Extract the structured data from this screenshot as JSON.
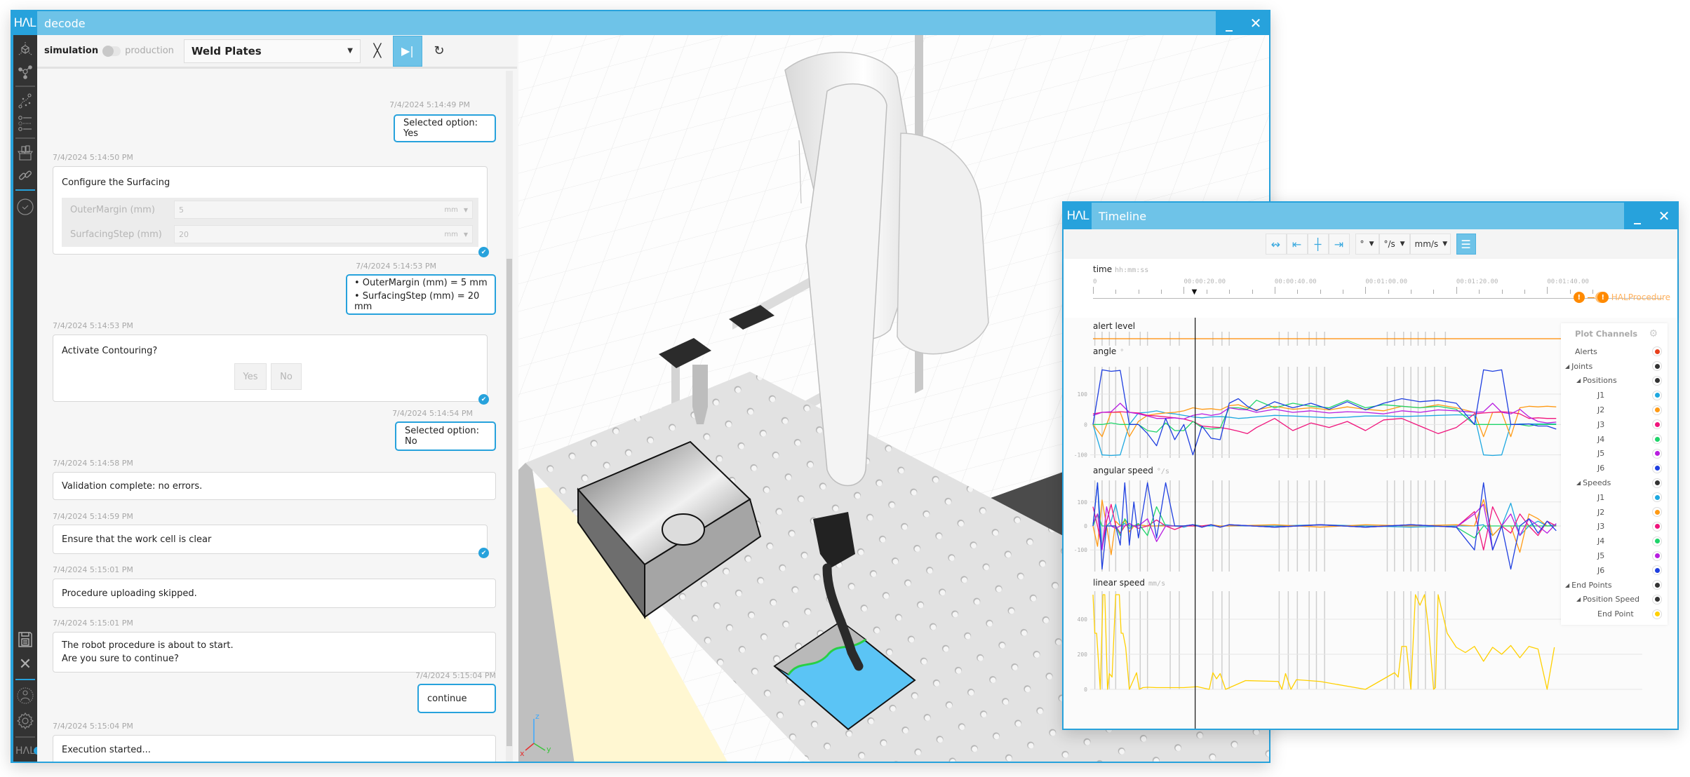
{
  "main_window": {
    "logo": "HΛL",
    "title": "decode",
    "minimize_label": "_",
    "close_label": "✕"
  },
  "sidebar": {
    "items": [
      {
        "name": "scene",
        "icon": "cube-axes-icon"
      },
      {
        "name": "graph",
        "icon": "node-graph-icon"
      },
      {
        "name": "paths",
        "icon": "path-plan-icon"
      },
      {
        "name": "settings-list",
        "icon": "parameter-list-icon"
      },
      {
        "name": "products",
        "icon": "box-parts-icon"
      },
      {
        "name": "links",
        "icon": "link-icon"
      },
      {
        "name": "validate",
        "icon": "check-circle-icon"
      }
    ],
    "bottom_items": [
      {
        "name": "save",
        "icon": "floppy-save-icon"
      },
      {
        "name": "close",
        "icon": "close-x-icon"
      },
      {
        "name": "user",
        "icon": "user-icon"
      },
      {
        "name": "settings",
        "icon": "gear-icon"
      }
    ],
    "footer_logo": "HΛL"
  },
  "toolbar": {
    "mode_left": "simulation",
    "mode_right": "production",
    "mode_production_on": false,
    "procedure_selected": "Weld Plates",
    "stop_symbol": "╳",
    "step_symbol": "▶|",
    "reset_symbol": "↻"
  },
  "chat": {
    "messages": [
      {
        "from": "user",
        "time": "7/4/2024 5:14:49 PM",
        "text": "Selected option: Yes"
      },
      {
        "from": "system",
        "time": "7/4/2024 5:14:50 PM",
        "text": "Configure the Surfacing",
        "form": [
          {
            "label": "OuterMargin (mm)",
            "value": "5",
            "unit": "mm"
          },
          {
            "label": "SurfacingStep (mm)",
            "value": "20",
            "unit": "mm"
          }
        ],
        "confirmed": true
      },
      {
        "from": "user",
        "time": "7/4/2024 5:14:53 PM",
        "lines": [
          "• OuterMargin (mm) = 5 mm",
          "• SurfacingStep (mm) = 20 mm"
        ]
      },
      {
        "from": "system",
        "time": "7/4/2024 5:14:53 PM",
        "text": "Activate Contouring?",
        "buttons": [
          "Yes",
          "No"
        ],
        "confirmed": true
      },
      {
        "from": "user",
        "time": "7/4/2024 5:14:54 PM",
        "text": "Selected option: No"
      },
      {
        "from": "system",
        "time": "7/4/2024 5:14:58 PM",
        "text": "Validation complete: no errors."
      },
      {
        "from": "system",
        "time": "7/4/2024 5:14:59 PM",
        "text": "Ensure that the work cell is clear",
        "confirmed": true
      },
      {
        "from": "system",
        "time": "7/4/2024 5:15:01 PM",
        "text": "Procedure uploading skipped."
      },
      {
        "from": "system",
        "time": "7/4/2024 5:15:01 PM",
        "lines": [
          "The robot procedure is about to start.",
          "Are you sure to continue?"
        ]
      },
      {
        "from": "user",
        "time": "7/4/2024 5:15:04 PM",
        "text": "continue"
      },
      {
        "from": "system",
        "time": "7/4/2024 5:15:04 PM",
        "text": "Execution started..."
      }
    ]
  },
  "viewport": {
    "axis_labels": {
      "x": "x",
      "y": "y",
      "z": "z"
    },
    "colors": {
      "workpiece": "#5bc4f5",
      "table": "#d8d8d8",
      "robot": "#f2f2f2"
    }
  },
  "timeline": {
    "logo": "HΛL",
    "title": "Timeline",
    "minimize_label": "_",
    "close_label": "✕",
    "toolbar": {
      "buttons": [
        {
          "name": "fit-all",
          "symbol": "↭"
        },
        {
          "name": "go-start",
          "symbol": "⇤"
        },
        {
          "name": "center-cursor",
          "symbol": "┼"
        },
        {
          "name": "go-end",
          "symbol": "⇥"
        }
      ],
      "unit_selects": [
        {
          "name": "angle-unit",
          "value": "°"
        },
        {
          "name": "angular-speed-unit",
          "value": "°/s"
        },
        {
          "name": "linear-speed-unit",
          "value": "mm/s"
        }
      ],
      "menu_symbol": "☰"
    },
    "time_axis": {
      "label": "time",
      "unit": "hh:mm:ss",
      "ticks": [
        "0",
        "00:00:20.00",
        "00:00:40.00",
        "00:01:00.00",
        "00:01:20.00",
        "00:01:40.00"
      ],
      "cursor_time_s": 22.5,
      "duration_s": 112,
      "procedure_label": "HALProcedure"
    },
    "plot_channels": {
      "title": "Plot Channels",
      "items": [
        {
          "label": "Alerts",
          "level": 0,
          "expand": false,
          "color": "#e8401c"
        },
        {
          "label": "Joints",
          "level": 0,
          "expand": true,
          "color": "#333333"
        },
        {
          "label": "Positions",
          "level": 1,
          "expand": true,
          "color": "#333333"
        },
        {
          "label": "J1",
          "level": 2,
          "expand": false,
          "color": "#1ea8e0"
        },
        {
          "label": "J2",
          "level": 2,
          "expand": false,
          "color": "#ff9a14"
        },
        {
          "label": "J3",
          "level": 2,
          "expand": false,
          "color": "#f0147c"
        },
        {
          "label": "J4",
          "level": 2,
          "expand": false,
          "color": "#1fd46a"
        },
        {
          "label": "J5",
          "level": 2,
          "expand": false,
          "color": "#b81ee0"
        },
        {
          "label": "J6",
          "level": 2,
          "expand": false,
          "color": "#1f3fe0"
        },
        {
          "label": "Speeds",
          "level": 1,
          "expand": true,
          "color": "#333333"
        },
        {
          "label": "J1",
          "level": 2,
          "expand": false,
          "color": "#1ea8e0"
        },
        {
          "label": "J2",
          "level": 2,
          "expand": false,
          "color": "#ff9a14"
        },
        {
          "label": "J3",
          "level": 2,
          "expand": false,
          "color": "#f0147c"
        },
        {
          "label": "J4",
          "level": 2,
          "expand": false,
          "color": "#1fd46a"
        },
        {
          "label": "J5",
          "level": 2,
          "expand": false,
          "color": "#b81ee0"
        },
        {
          "label": "J6",
          "level": 2,
          "expand": false,
          "color": "#1f3fe0"
        },
        {
          "label": "End Points",
          "level": 0,
          "expand": true,
          "color": "#333333"
        },
        {
          "label": "Position Speed",
          "level": 1,
          "expand": true,
          "color": "#333333"
        },
        {
          "label": "End Point",
          "level": 2,
          "expand": false,
          "color": "#ffd000"
        }
      ]
    }
  },
  "chart_data": [
    {
      "type": "line",
      "title": "alert level",
      "xlabel": "time (s)",
      "ylabel": "",
      "series": [
        {
          "name": "Alerts",
          "color": "#ff8a00",
          "x": [
            0,
            112
          ],
          "y": [
            0,
            0
          ]
        }
      ]
    },
    {
      "type": "line",
      "title": "angle",
      "ylabel": "°",
      "ylim": [
        -110,
        190
      ],
      "yticks": [
        -100,
        0,
        100
      ],
      "x": [
        0,
        2,
        4,
        6,
        8,
        10,
        12,
        14,
        16,
        18,
        20,
        22,
        24,
        26,
        28,
        30,
        32,
        34,
        36,
        40,
        44,
        48,
        52,
        56,
        60,
        64,
        68,
        72,
        76,
        80,
        84,
        86,
        88,
        90,
        92,
        94,
        96,
        98,
        100,
        102
      ],
      "series": [
        {
          "name": "J1",
          "color": "#1ea8e0",
          "values": [
            0,
            -100,
            -102,
            -100,
            0,
            38,
            40,
            45,
            38,
            35,
            30,
            25,
            22,
            25,
            26,
            24,
            20,
            22,
            25,
            30,
            28,
            25,
            22,
            24,
            28,
            28,
            26,
            28,
            30,
            32,
            30,
            -100,
            -102,
            -100,
            0,
            2,
            2,
            2,
            2,
            2
          ]
        },
        {
          "name": "J2",
          "color": "#ff9a14",
          "values": [
            0,
            -40,
            40,
            40,
            -40,
            10,
            30,
            35,
            38,
            40,
            45,
            55,
            50,
            52,
            48,
            62,
            65,
            55,
            48,
            60,
            50,
            55,
            48,
            58,
            50,
            45,
            60,
            55,
            65,
            55,
            40,
            -40,
            40,
            40,
            -40,
            55,
            60,
            58,
            60,
            58
          ]
        },
        {
          "name": "J3",
          "color": "#f0147c",
          "values": [
            35,
            40,
            40,
            42,
            40,
            38,
            30,
            28,
            25,
            22,
            18,
            10,
            -5,
            -8,
            -10,
            -15,
            -22,
            -30,
            -10,
            20,
            -20,
            5,
            -10,
            10,
            -20,
            15,
            20,
            -5,
            -30,
            -10,
            35,
            38,
            40,
            42,
            40,
            35,
            20,
            22,
            20,
            20
          ]
        },
        {
          "name": "J4",
          "color": "#1fd46a",
          "values": [
            0,
            0,
            5,
            0,
            0,
            0,
            -20,
            -25,
            5,
            -20,
            -20,
            10,
            -10,
            -15,
            -12,
            55,
            55,
            50,
            80,
            55,
            70,
            60,
            55,
            80,
            55,
            65,
            60,
            55,
            60,
            50,
            0,
            0,
            0,
            0,
            0,
            0,
            -5,
            0,
            0,
            0
          ]
        },
        {
          "name": "J5",
          "color": "#b81ee0",
          "values": [
            30,
            40,
            42,
            70,
            40,
            35,
            28,
            20,
            20,
            22,
            18,
            30,
            35,
            30,
            35,
            55,
            50,
            48,
            40,
            50,
            40,
            45,
            38,
            42,
            40,
            35,
            45,
            40,
            48,
            45,
            40,
            42,
            70,
            40,
            35,
            50,
            25,
            10,
            5,
            8
          ]
        },
        {
          "name": "J6",
          "color": "#1f3fe0",
          "values": [
            0,
            180,
            175,
            178,
            0,
            0,
            -30,
            -70,
            20,
            -50,
            0,
            -100,
            -5,
            -45,
            -50,
            70,
            85,
            60,
            45,
            75,
            55,
            70,
            50,
            75,
            48,
            70,
            85,
            75,
            80,
            70,
            0,
            180,
            175,
            180,
            0,
            0,
            2,
            -5,
            -5,
            -15
          ]
        }
      ]
    },
    {
      "type": "line",
      "title": "angular speed",
      "ylabel": "°/s",
      "ylim": [
        -190,
        190
      ],
      "yticks": [
        -100,
        0,
        100
      ],
      "x": [
        0,
        1,
        2,
        3,
        4,
        5,
        6,
        7,
        8,
        9,
        10,
        12,
        14,
        16,
        18,
        20,
        22,
        24,
        26,
        28,
        30,
        40,
        50,
        60,
        70,
        80,
        84,
        86,
        88,
        90,
        92,
        94,
        96,
        98,
        100,
        102
      ],
      "series": [
        {
          "name": "J1",
          "color": "#1ea8e0",
          "values": [
            0,
            180,
            -95,
            0,
            20,
            90,
            0,
            10,
            -10,
            0,
            5,
            0,
            0,
            5,
            0,
            -5,
            5,
            0,
            0,
            0,
            0,
            0,
            5,
            0,
            -5,
            0,
            0,
            5,
            -40,
            0,
            95,
            -40,
            0,
            20,
            0,
            5
          ]
        },
        {
          "name": "J2",
          "color": "#ff9a14",
          "values": [
            0,
            -85,
            108,
            0,
            -120,
            20,
            0,
            25,
            -25,
            0,
            5,
            0,
            0,
            0,
            0,
            0,
            0,
            0,
            5,
            0,
            0,
            5,
            -5,
            5,
            0,
            5,
            0,
            110,
            -40,
            0,
            0,
            -110,
            50,
            30,
            0,
            0
          ]
        },
        {
          "name": "J3",
          "color": "#f0147c",
          "values": [
            80,
            0,
            -95,
            20,
            90,
            0,
            -30,
            0,
            10,
            0,
            -10,
            0,
            25,
            0,
            -15,
            0,
            0,
            0,
            5,
            -5,
            5,
            -5,
            5,
            -5,
            5,
            -5,
            60,
            -100,
            80,
            0,
            -30,
            50,
            0,
            -40,
            20,
            0
          ]
        },
        {
          "name": "J4",
          "color": "#1fd46a",
          "values": [
            0,
            50,
            0,
            0,
            0,
            0,
            -40,
            30,
            0,
            0,
            10,
            -40,
            80,
            0,
            0,
            0,
            5,
            -5,
            5,
            -5,
            5,
            -5,
            5,
            -5,
            5,
            -5,
            -50,
            0,
            0,
            0,
            0,
            0,
            0,
            0,
            0,
            0
          ]
        },
        {
          "name": "J5",
          "color": "#b81ee0",
          "values": [
            10,
            50,
            -100,
            80,
            0,
            -10,
            0,
            0,
            10,
            0,
            0,
            30,
            -65,
            0,
            0,
            0,
            5,
            -5,
            5,
            -5,
            5,
            -5,
            5,
            -5,
            5,
            -5,
            50,
            90,
            -100,
            0,
            50,
            -40,
            30,
            0,
            -30,
            10
          ]
        },
        {
          "name": "J6",
          "color": "#1f3fe0",
          "values": [
            0,
            180,
            -180,
            0,
            0,
            0,
            -80,
            180,
            -80,
            100,
            -50,
            180,
            -50,
            180,
            0,
            0,
            5,
            -5,
            5,
            -5,
            5,
            -5,
            5,
            -5,
            5,
            -5,
            -100,
            180,
            -100,
            0,
            -180,
            0,
            30,
            -30,
            20,
            -20
          ]
        }
      ]
    },
    {
      "type": "line",
      "title": "linear speed",
      "ylabel": "mm/s",
      "ylim": [
        0,
        560
      ],
      "yticks": [
        0,
        200,
        400
      ],
      "series": [
        {
          "name": "End Point",
          "color": "#ffd000",
          "x": [
            0,
            0.4,
            0.8,
            1.6,
            2.2,
            2.6,
            3.2,
            3.6,
            4.2,
            5,
            5.8,
            6.2,
            6.6,
            7.2,
            8,
            9.6,
            10.2,
            11,
            12,
            14,
            20,
            23,
            25.6,
            26.4,
            27.2,
            28,
            29.2,
            33.6,
            40.8,
            41.6,
            42.4,
            43.6,
            44.8,
            50,
            60,
            66.4,
            67.2,
            68,
            69,
            70,
            71,
            72,
            73,
            74,
            75,
            75.4,
            76,
            78,
            80,
            82,
            84,
            86,
            88,
            90,
            92,
            94,
            96,
            98,
            100,
            101.6
          ],
          "values": [
            540,
            320,
            320,
            0,
            540,
            540,
            0,
            90,
            70,
            540,
            540,
            320,
            320,
            240,
            0,
            95,
            0,
            10,
            12,
            10,
            10,
            15,
            0,
            95,
            60,
            90,
            0,
            50,
            45,
            0,
            90,
            0,
            55,
            45,
            0,
            95,
            70,
            245,
            245,
            0,
            540,
            480,
            540,
            320,
            0,
            10,
            540,
            320,
            240,
            210,
            245,
            160,
            240,
            200,
            250,
            180,
            245,
            230,
            0,
            240
          ]
        }
      ]
    }
  ]
}
